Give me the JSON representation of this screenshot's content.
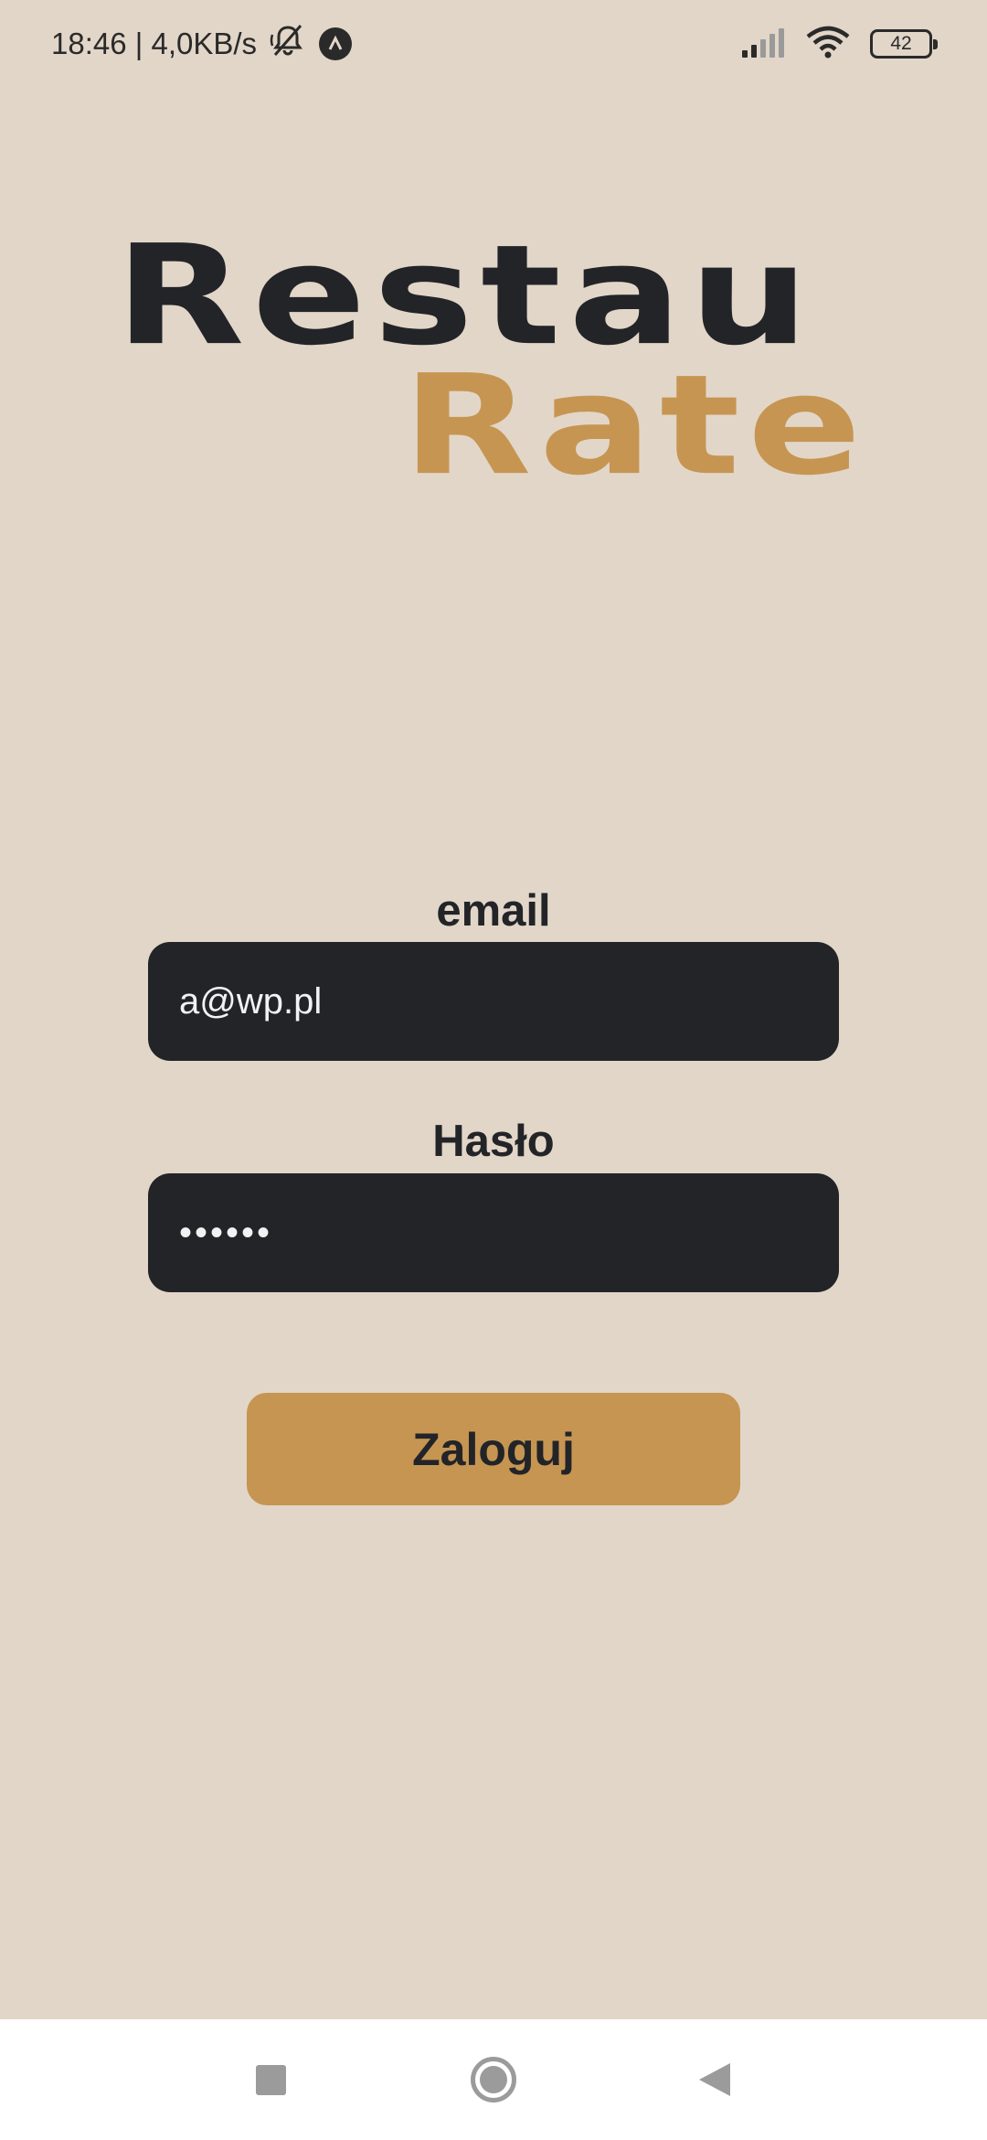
{
  "status_bar": {
    "time_speed": "18:46 | 4,0KB/s",
    "battery": "42",
    "icons": [
      "bell-off-icon",
      "nav-app-icon",
      "signal-icon",
      "wifi-icon",
      "battery-icon"
    ]
  },
  "logo": {
    "line1": "Restau",
    "line2": "Rate"
  },
  "form": {
    "email_label": "email",
    "email_value": "a@wp.pl",
    "password_label": "Hasło",
    "password_value": "••••••",
    "login_label": "Zaloguj"
  },
  "colors": {
    "background": "#e2d6c8",
    "dark": "#222428",
    "accent": "#c69552"
  },
  "nav_bar": {
    "icons": [
      "recents-icon",
      "home-icon",
      "back-icon"
    ]
  }
}
